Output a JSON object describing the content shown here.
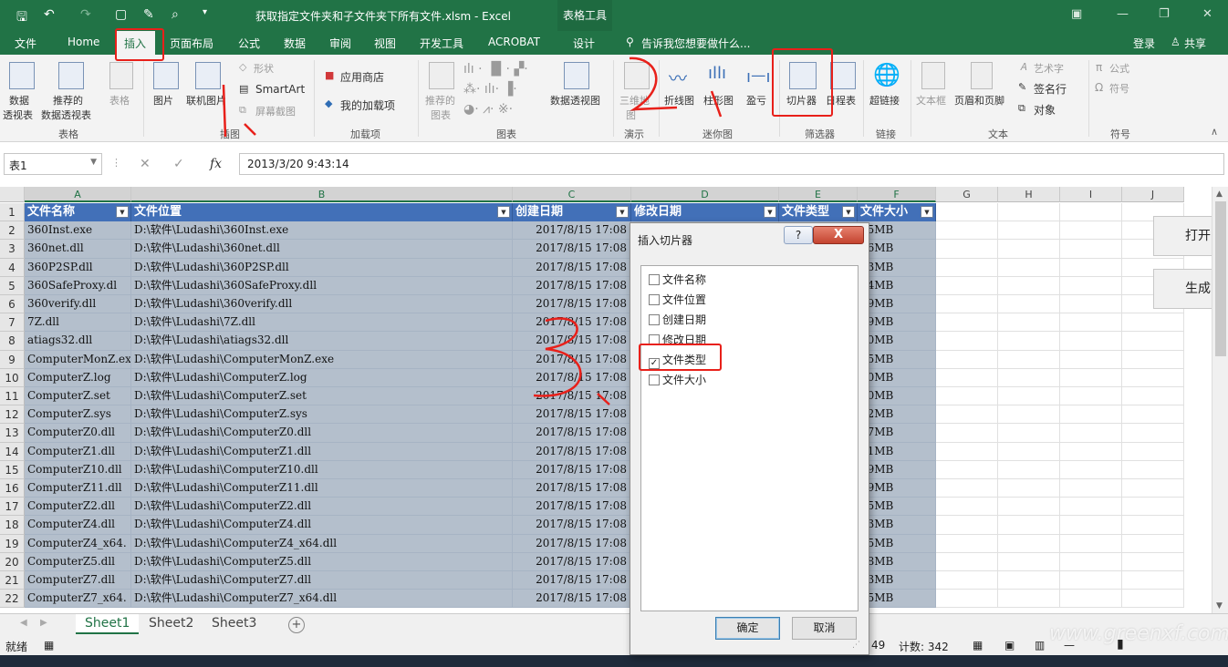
{
  "window": {
    "title": "获取指定文件夹和子文件夹下所有文件.xlsm - Excel",
    "context_tab": "表格工具"
  },
  "tabs": [
    "文件",
    "Home",
    "插入",
    "页面布局",
    "公式",
    "数据",
    "审阅",
    "视图",
    "开发工具",
    "ACROBAT",
    "设计"
  ],
  "active_tab": "插入",
  "tell_me": "告诉我您想要做什么...",
  "account": {
    "login": "登录",
    "share": "共享"
  },
  "ribbon": {
    "pivot_table": [
      "数据",
      "透视表"
    ],
    "recommended_pivot": [
      "推荐的",
      "数据透视表"
    ],
    "table": "表格",
    "picture": "图片",
    "online_picture": "联机图片",
    "shapes": "形状",
    "smartart": "SmartArt",
    "screenshot": "屏幕截图",
    "store": "应用商店",
    "my_addins": "我的加载项",
    "recommended_charts": [
      "推荐的",
      "图表"
    ],
    "pivot_chart": "数据透视图",
    "power_map": [
      "三维地",
      "图"
    ],
    "line": "折线图",
    "column": "柱形图",
    "winloss": "盈亏",
    "slicer": "切片器",
    "timeline": "日程表",
    "hyperlink": "超链接",
    "textbox": "文本框",
    "header_footer": "页眉和页脚",
    "wordart": "艺术字",
    "signature": "签名行",
    "object": "对象",
    "equation": "公式",
    "symbol": "符号",
    "groups": [
      "表格",
      "插图",
      "加载项",
      "图表",
      "演示",
      "迷你图",
      "筛选器",
      "链接",
      "文本",
      "符号"
    ]
  },
  "formula_bar": {
    "name_box": "表1",
    "fx": "fx",
    "value": "2013/3/20  9:43:14"
  },
  "columns": [
    "A",
    "B",
    "C",
    "D",
    "E",
    "F",
    "G",
    "H",
    "I",
    "J"
  ],
  "table_headers": [
    "文件名称",
    "文件位置",
    "创建日期",
    "修改日期",
    "文件类型",
    "文件大小"
  ],
  "rows": [
    [
      "360Inst.exe",
      "D:\\软件\\Ludashi\\360Inst.exe",
      "2017/8/15 17:08",
      "85MB"
    ],
    [
      "360net.dll",
      "D:\\软件\\Ludashi\\360net.dll",
      "2017/8/15 17:08",
      "26MB"
    ],
    [
      "360P2SP.dll",
      "D:\\软件\\Ludashi\\360P2SP.dll",
      "2017/8/15 17:08",
      "53MB"
    ],
    [
      "360SafeProxy.dl",
      "D:\\软件\\Ludashi\\360SafeProxy.dll",
      "2017/8/15 17:08",
      "04MB"
    ],
    [
      "360verify.dll",
      "D:\\软件\\Ludashi\\360verify.dll",
      "2017/8/15 17:08",
      "09MB"
    ],
    [
      "7Z.dll",
      "D:\\软件\\Ludashi\\7Z.dll",
      "2017/8/15 17:08",
      "59MB"
    ],
    [
      "atiags32.dll",
      "D:\\软件\\Ludashi\\atiags32.dll",
      "2017/8/15 17:08",
      "20MB"
    ],
    [
      "ComputerMonZ.ex",
      "D:\\软件\\Ludashi\\ComputerMonZ.exe",
      "2017/8/15 17:08",
      "55MB"
    ],
    [
      "ComputerZ.log",
      "D:\\软件\\Ludashi\\ComputerZ.log",
      "2017/8/15 17:08",
      "00MB"
    ],
    [
      "ComputerZ.set",
      "D:\\软件\\Ludashi\\ComputerZ.set",
      "2017/8/15 17:08",
      "00MB"
    ],
    [
      "ComputerZ.sys",
      "D:\\软件\\Ludashi\\ComputerZ.sys",
      "2017/8/15 17:08",
      "02MB"
    ],
    [
      "ComputerZ0.dll",
      "D:\\软件\\Ludashi\\ComputerZ0.dll",
      "2017/8/15 17:08",
      "47MB"
    ],
    [
      "ComputerZ1.dll",
      "D:\\软件\\Ludashi\\ComputerZ1.dll",
      "2017/8/15 17:08",
      "51MB"
    ],
    [
      "ComputerZ10.dll",
      "D:\\软件\\Ludashi\\ComputerZ10.dll",
      "2017/8/15 17:08",
      "09MB"
    ],
    [
      "ComputerZ11.dll",
      "D:\\软件\\Ludashi\\ComputerZ11.dll",
      "2017/8/15 17:08",
      "09MB"
    ],
    [
      "ComputerZ2.dll",
      "D:\\软件\\Ludashi\\ComputerZ2.dll",
      "2017/8/15 17:08",
      "15MB"
    ],
    [
      "ComputerZ4.dll",
      "D:\\软件\\Ludashi\\ComputerZ4.dll",
      "2017/8/15 17:08",
      "23MB"
    ],
    [
      "ComputerZ4_x64.",
      "D:\\软件\\Ludashi\\ComputerZ4_x64.dll",
      "2017/8/15 17:08",
      "25MB"
    ],
    [
      "ComputerZ5.dll",
      "D:\\软件\\Ludashi\\ComputerZ5.dll",
      "2017/8/15 17:08",
      "18MB"
    ],
    [
      "ComputerZ7.dll",
      "D:\\软件\\Ludashi\\ComputerZ7.dll",
      "2017/8/15 17:08",
      "13MB"
    ],
    [
      "ComputerZ7_x64.",
      "D:\\软件\\Ludashi\\ComputerZ7_x64.dll",
      "2017/8/15 17:08",
      "15MB"
    ]
  ],
  "side_buttons": [
    "打开",
    "生成"
  ],
  "sheets": [
    "Sheet1",
    "Sheet2",
    "Sheet3"
  ],
  "active_sheet": "Sheet1",
  "status": {
    "ready": "就绪",
    "count_label": "计数: 342",
    "left_fragment": "49"
  },
  "dialog": {
    "title": "插入切片器",
    "help": "?",
    "close": "X",
    "fields": [
      {
        "label": "文件名称",
        "checked": false
      },
      {
        "label": "文件位置",
        "checked": false
      },
      {
        "label": "创建日期",
        "checked": false
      },
      {
        "label": "修改日期",
        "checked": false
      },
      {
        "label": "文件类型",
        "checked": true
      },
      {
        "label": "文件大小",
        "checked": false
      }
    ],
    "ok": "确定",
    "cancel": "取消"
  },
  "watermark": "www.greenxf.com",
  "colors": {
    "excel_green": "#217346",
    "table_header": "#4270b8",
    "table_body": "#b4bfcc",
    "annotation_red": "#e8201a"
  }
}
